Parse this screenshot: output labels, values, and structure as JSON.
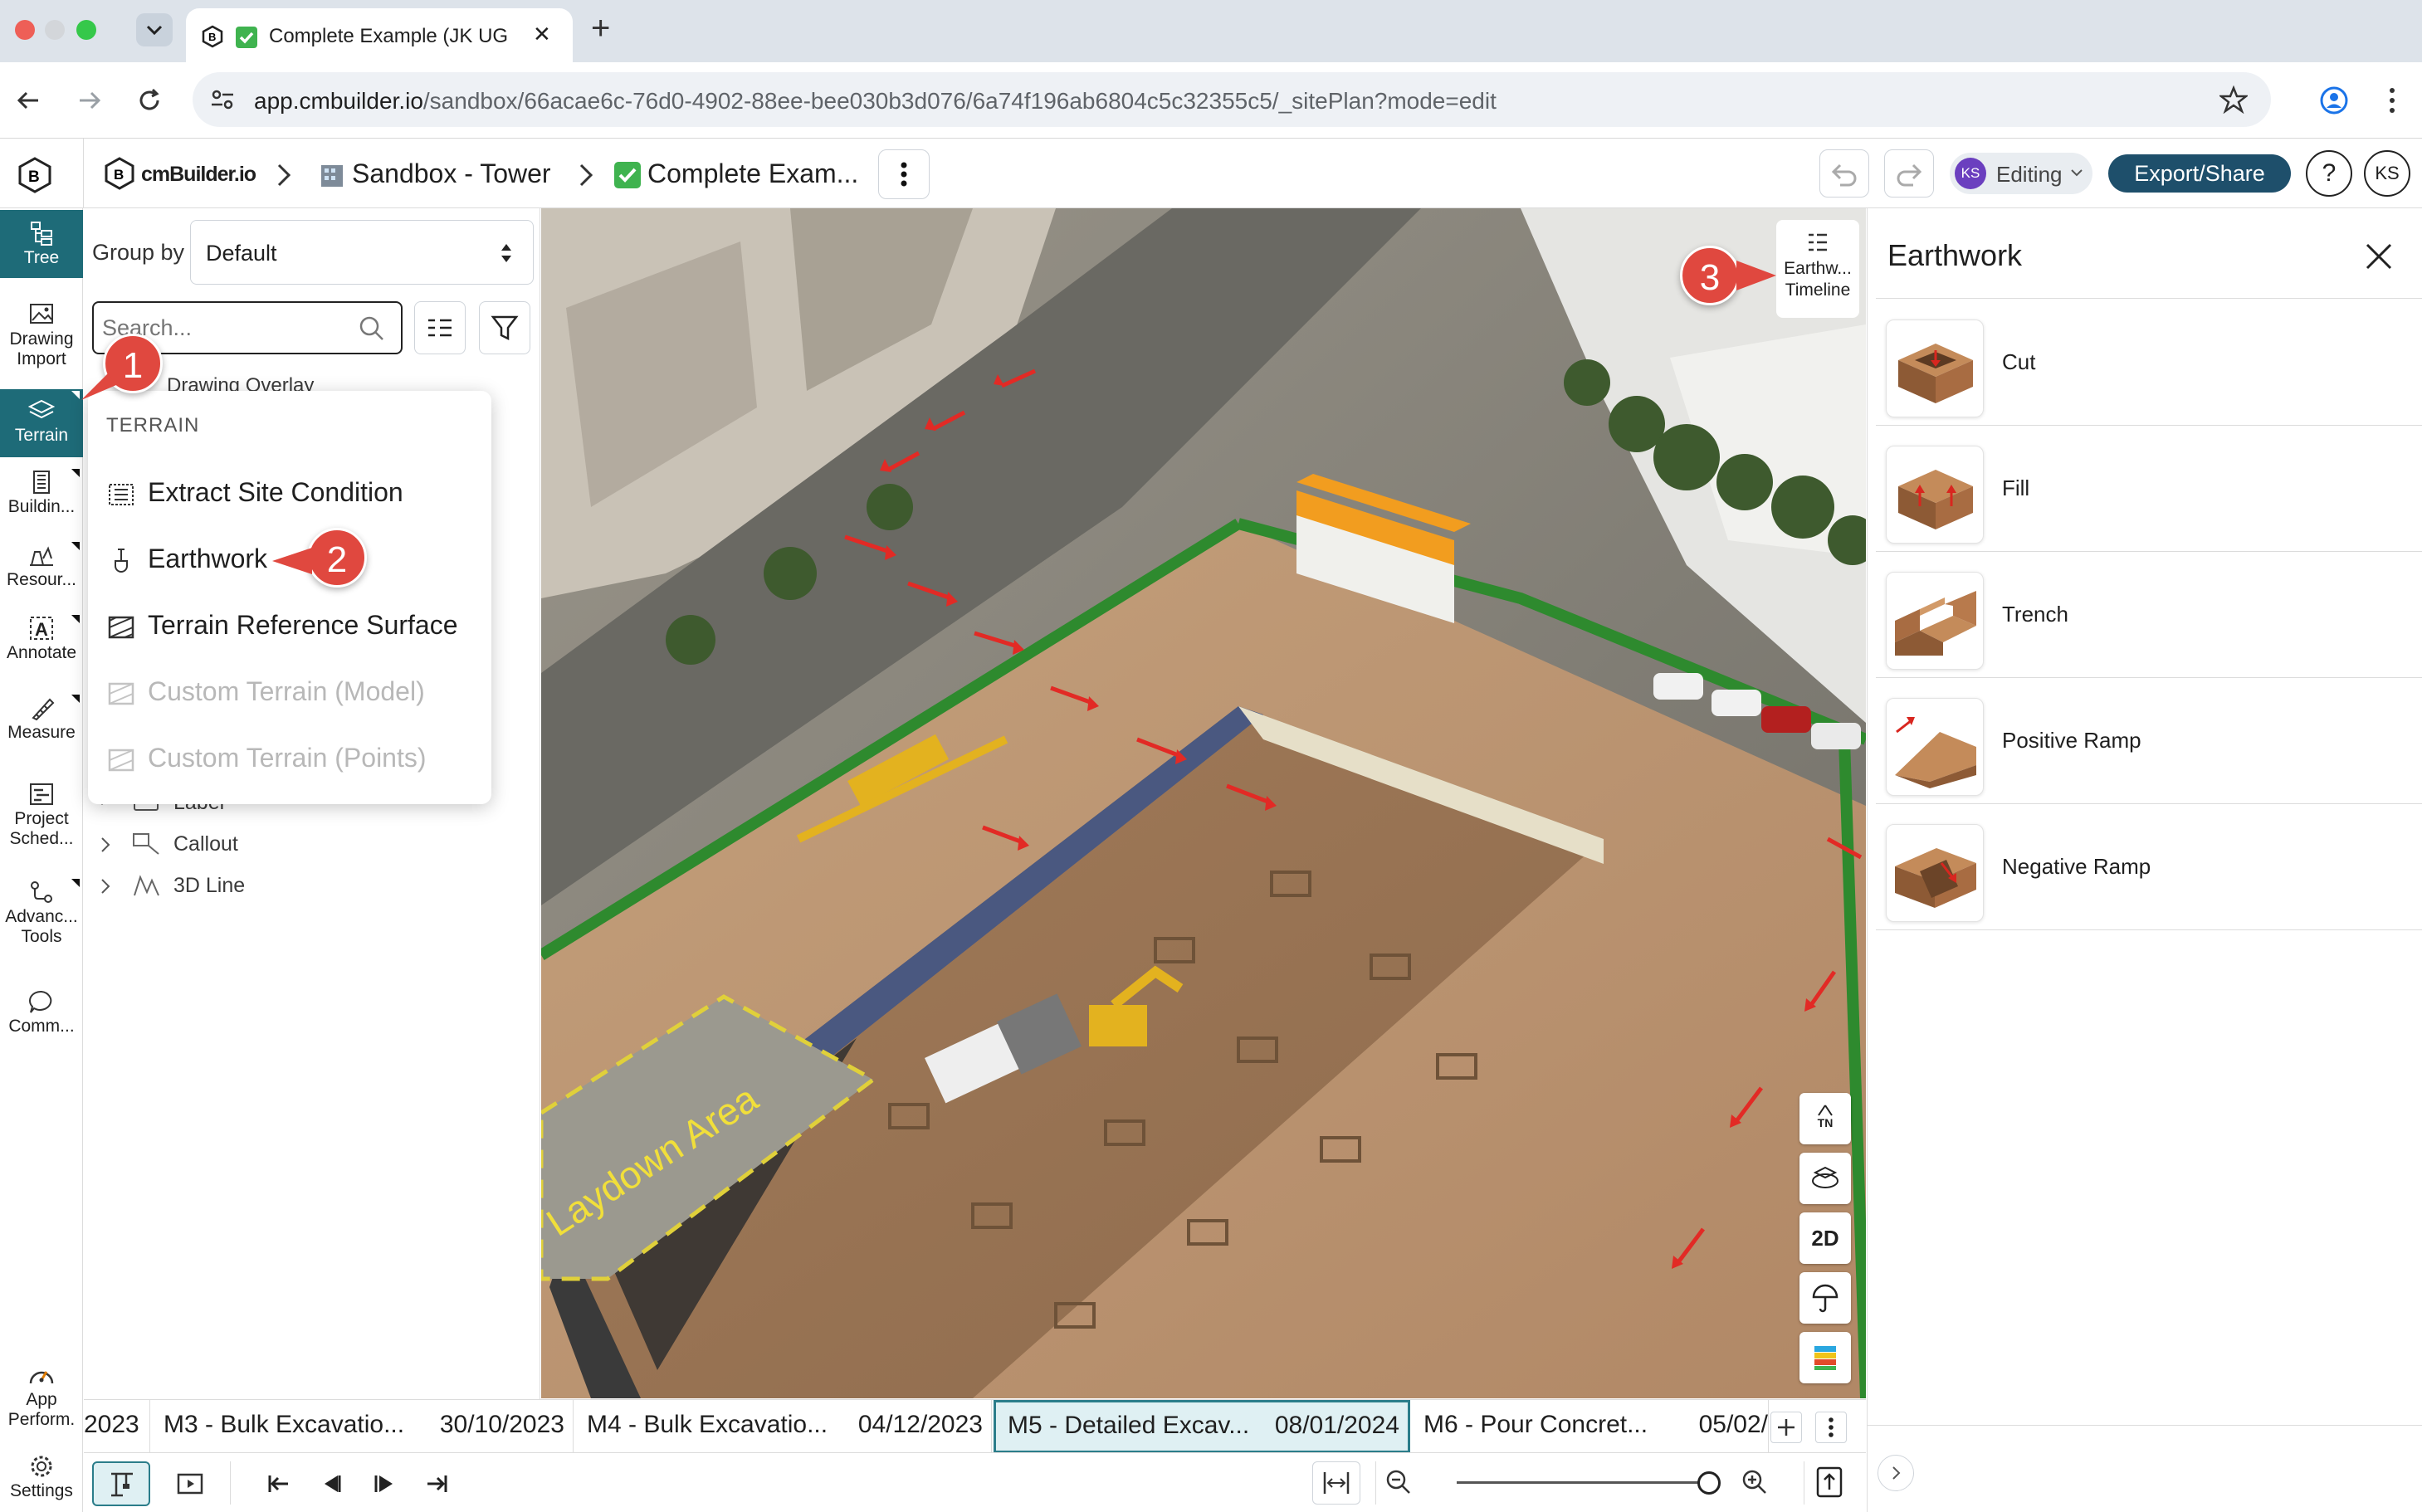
{
  "browser": {
    "tab_title": "Complete Example (JK UG",
    "new_tab_symbol": "+",
    "tab_close_symbol": "✕",
    "url_host": "app.cmbuilder.io",
    "url_path": "/sandbox/66acae6c-76d0-4902-88ee-bee030b3d076/6a74f196ab6804c5c32355c5/_sitePlan?mode=edit"
  },
  "header": {
    "logo_text": "cmBuilder.io",
    "crumb_sandbox": "Sandbox - Tower",
    "crumb_project": "Complete Exam...",
    "avatar_small": "KS",
    "editing_label": "Editing",
    "export_label": "Export/Share",
    "help_symbol": "?",
    "user_initials": "KS"
  },
  "rail": {
    "tree": "Tree",
    "drawing_import_1": "Drawing",
    "drawing_import_2": "Import",
    "terrain": "Terrain",
    "building": "Buildin...",
    "resources": "Resour...",
    "annotate": "Annotate",
    "measure": "Measure",
    "project_1": "Project",
    "project_2": "Sched...",
    "advanced_1": "Advanc...",
    "advanced_2": "Tools",
    "comments": "Comm...",
    "perf_1": "App",
    "perf_2": "Perform.",
    "settings": "Settings"
  },
  "left_panel": {
    "group_by_label": "Group by",
    "group_by_value": "Default",
    "search_placeholder": "Search...",
    "tree_partial": "Drawing Overlay",
    "tree_label": "Label",
    "tree_callout": "Callout",
    "tree_3dline": "3D Line"
  },
  "terrain_menu": {
    "header": "TERRAIN",
    "items": [
      {
        "label": "Extract Site Condition",
        "enabled": true
      },
      {
        "label": "Earthwork",
        "enabled": true
      },
      {
        "label": "Terrain Reference Surface",
        "enabled": true
      },
      {
        "label": "Custom Terrain (Model)",
        "enabled": false
      },
      {
        "label": "Custom Terrain (Points)",
        "enabled": false
      }
    ]
  },
  "callouts": [
    "1",
    "2",
    "3"
  ],
  "viewport": {
    "timeline_btn_1": "Earthw...",
    "timeline_btn_2": "Timeline",
    "laydown_text": "Laydown Area",
    "btn_tn": "TN",
    "btn_2d": "2D"
  },
  "right_panel": {
    "title": "Earthwork",
    "items": [
      "Cut",
      "Fill",
      "Trench",
      "Positive Ramp",
      "Negative Ramp"
    ]
  },
  "milestones": [
    {
      "label": "",
      "date": "2023"
    },
    {
      "label": "M3 - Bulk Excavatio...",
      "date": "30/10/2023"
    },
    {
      "label": "M4 - Bulk Excavatio...",
      "date": "04/12/2023"
    },
    {
      "label": "M5 - Detailed Excav...",
      "date": "08/01/2024"
    },
    {
      "label": "M6 - Pour Concret...",
      "date": "05/02/"
    }
  ],
  "colors": {
    "accent_teal": "#1e6b78",
    "export_button": "#1e4f6b",
    "callout_red": "#e0483f",
    "editing_avatar": "#6b3fbf"
  }
}
